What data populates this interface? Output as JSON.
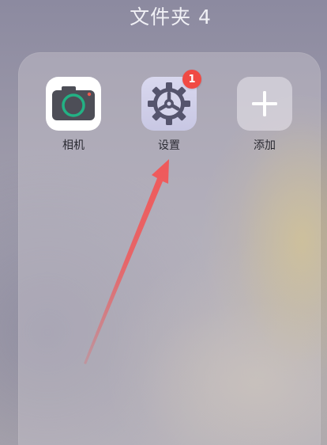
{
  "folder": {
    "title": "文件夹 4"
  },
  "apps": [
    {
      "label": "相机",
      "icon": "camera-icon"
    },
    {
      "label": "设置",
      "icon": "settings-gear-icon",
      "badge": "1"
    },
    {
      "label": "添加",
      "icon": "plus-icon"
    }
  ],
  "colors": {
    "badge": "#f04a44",
    "camera_ring": "#23b184",
    "camera_body": "#4d4e57",
    "settings_gear": "#55546d",
    "annotation_arrow": "#f0595a"
  }
}
